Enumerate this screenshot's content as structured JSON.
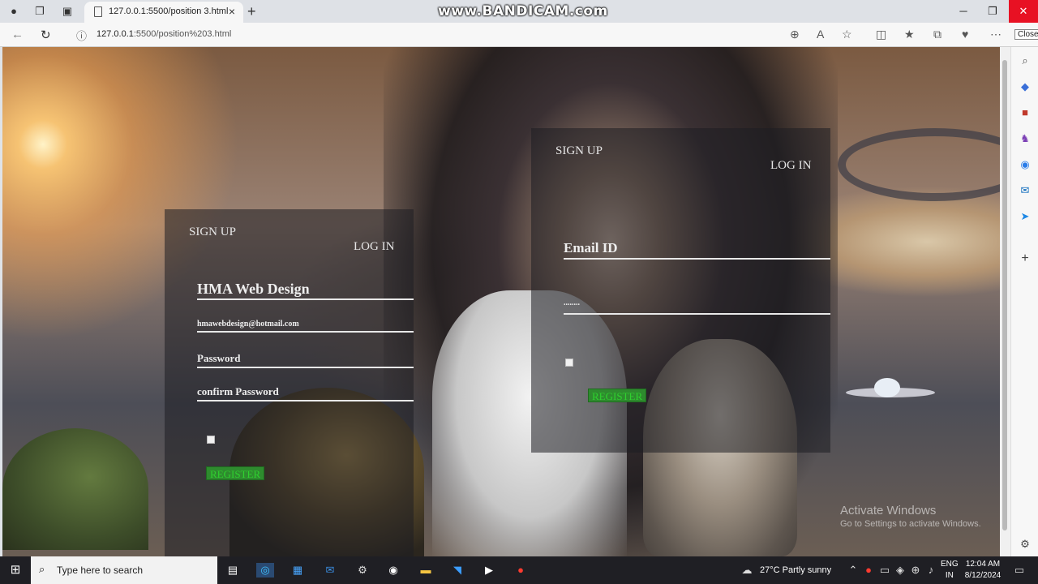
{
  "browser": {
    "tab_title": "127.0.0.1:5500/position 3.html",
    "url_host": "127.0.0.1",
    "url_path": ":5500/position%203.html",
    "overlay_watermark": "www.BANDICAM.com",
    "close_tooltip": "Close"
  },
  "left_form": {
    "sign_up": "SIGN UP",
    "log_in": "LOG IN",
    "name_field": "HMA Web Design",
    "email_field": "hmawebdesign@hotmail.com",
    "password_field": "Password",
    "confirm_password_field": "confirm Password",
    "register_button": "REGISTER"
  },
  "right_form": {
    "sign_up": "SIGN UP",
    "log_in": "LOG IN",
    "email_field": "Email ID",
    "password_field": "........",
    "register_button": "REGISTER"
  },
  "windows_watermark": {
    "line1": "Activate Windows",
    "line2": "Go to Settings to activate Windows."
  },
  "taskbar": {
    "search_placeholder": "Type here to search",
    "weather": "27°C  Partly sunny",
    "lang_top": "ENG",
    "lang_bottom": "IN",
    "time": "12:04 AM",
    "date": "8/12/2024"
  },
  "colors": {
    "register_green": "#2e8b2e",
    "close_red": "#e81123"
  }
}
